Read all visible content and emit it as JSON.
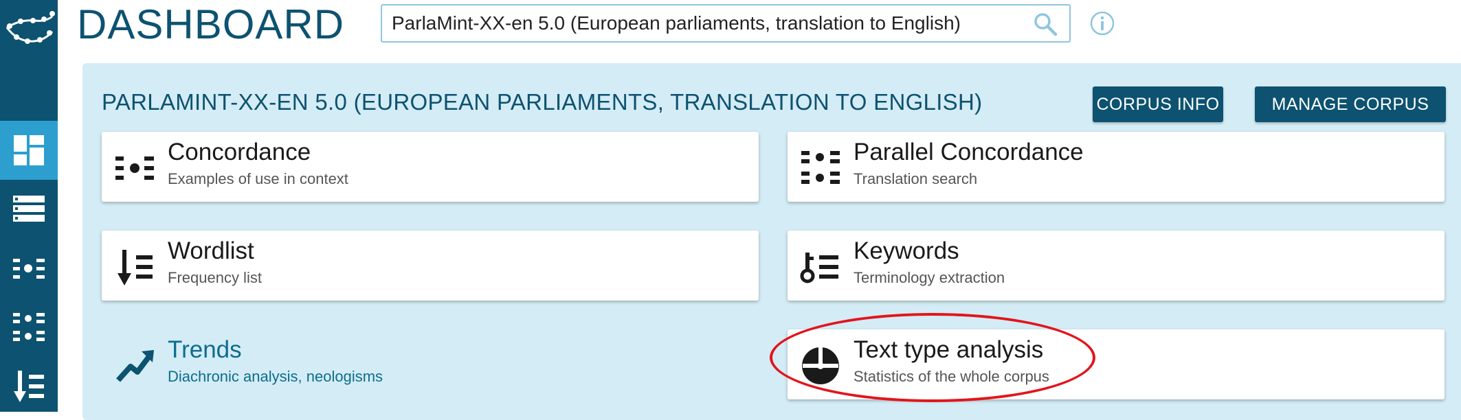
{
  "header": {
    "title": "DASHBOARD",
    "search_value": "ParlaMint-XX-en 5.0 (European parliaments, translation to English)"
  },
  "corpus": {
    "title": "PARLAMINT-XX-EN 5.0 (EUROPEAN PARLIAMENTS, TRANSLATION TO ENGLISH)",
    "info_label": "CORPUS INFO",
    "manage_label": "MANAGE CORPUS"
  },
  "tools": [
    {
      "title": "Concordance",
      "subtitle": "Examples of use in context",
      "icon": "concordance-icon"
    },
    {
      "title": "Parallel Concordance",
      "subtitle": "Translation search",
      "icon": "parallel-concordance-icon"
    },
    {
      "title": "Wordlist",
      "subtitle": "Frequency list",
      "icon": "wordlist-icon"
    },
    {
      "title": "Keywords",
      "subtitle": "Terminology extraction",
      "icon": "keywords-icon"
    },
    {
      "title": "Trends",
      "subtitle": "Diachronic analysis, neologisms",
      "icon": "trends-icon"
    },
    {
      "title": "Text type analysis",
      "subtitle": "Statistics of the whole corpus",
      "icon": "text-type-icon"
    }
  ],
  "sidebar": {
    "items": [
      "dashboard-icon",
      "list-icon",
      "concordance-icon",
      "parallel-concordance-icon",
      "wordlist-icon"
    ]
  },
  "colors": {
    "sidebar": "#0d5270",
    "sidebar_active": "#2c9fcf",
    "panel": "#d4ecf5",
    "annotation": "#e3141b"
  }
}
